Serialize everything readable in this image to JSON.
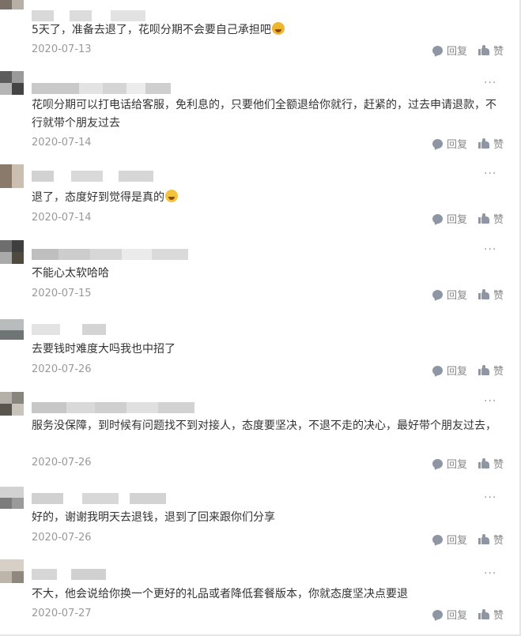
{
  "comments": [
    {
      "text": "5天了，准备去退了，花呗分期不会要自己承担吧",
      "emoji": "crying-emoji",
      "date": "2020-07-13",
      "reply": "回复",
      "like": "赞",
      "more": ""
    },
    {
      "text": "花呗分期可以打电话给客服，免利息的，只要他们全额退给你就行，赶紧的，过去申请退款，不行就带个朋友过去",
      "emoji": "",
      "date": "2020-07-14",
      "reply": "回复",
      "like": "赞",
      "more": "···"
    },
    {
      "text": "退了，态度好到觉得是真的",
      "emoji": "laughing-emoji",
      "date": "2020-07-14",
      "reply": "回复",
      "like": "赞",
      "more": "···"
    },
    {
      "text": "不能心太软哈哈",
      "emoji": "",
      "date": "2020-07-15",
      "reply": "回复",
      "like": "赞",
      "more": "···"
    },
    {
      "text": "去要钱时难度大吗我也中招了",
      "emoji": "",
      "date": "2020-07-26",
      "reply": "回复",
      "like": "赞",
      "more": "···"
    },
    {
      "text": "服务没保障，到时候有问题找不到对接人，态度要坚决，不退不走的决心，最好带个朋友过去，",
      "emoji": "",
      "date": "2020-07-26",
      "reply": "回复",
      "like": "赞",
      "more": "···"
    },
    {
      "text": "好的，谢谢我明天去退钱，退到了回来跟你们分享",
      "emoji": "",
      "date": "2020-07-26",
      "reply": "回复",
      "like": "赞",
      "more": "···"
    },
    {
      "text": "不大，他会说给你换一个更好的礼品或者降低套餐版本，你就态度坚决点要退",
      "emoji": "",
      "date": "2020-07-27",
      "reply": "回复",
      "like": "赞",
      "more": "···"
    }
  ],
  "colors": {
    "text": "#333333",
    "meta": "#999999",
    "icon": "#8f96a3"
  }
}
